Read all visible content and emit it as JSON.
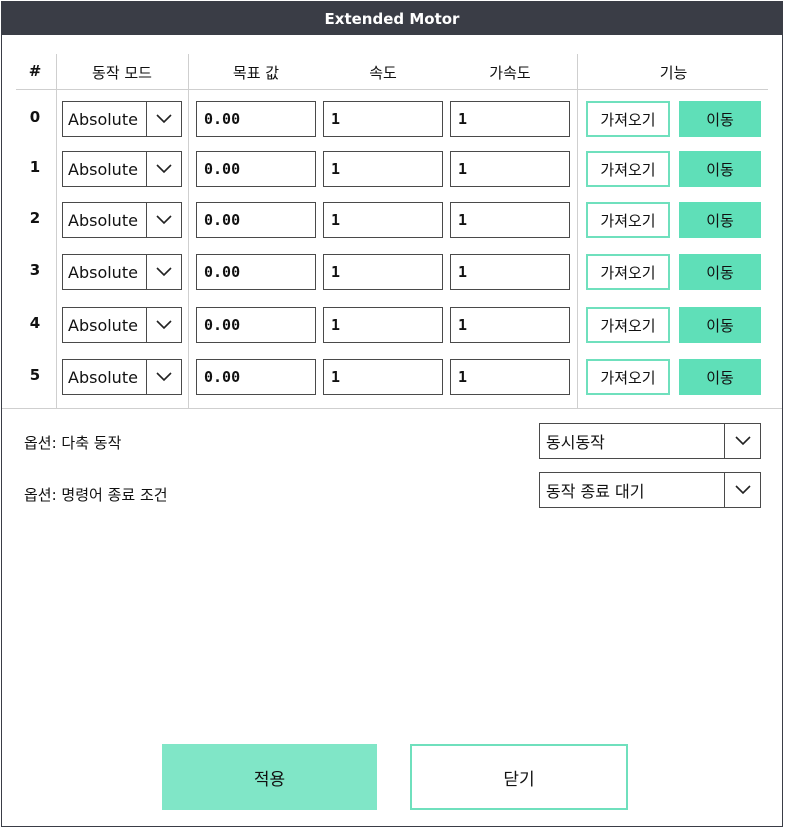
{
  "window": {
    "title": "Extended Motor"
  },
  "table": {
    "headers": {
      "index": "#",
      "mode": "동작 모드",
      "target": "목표 값",
      "speed": "속도",
      "accel": "가속도",
      "function": "기능"
    },
    "rows": [
      {
        "num": "0",
        "mode": "Absolute",
        "target": "0.00",
        "speed": "1",
        "accel": "1",
        "get_label": "가져오기",
        "move_label": "이동"
      },
      {
        "num": "1",
        "mode": "Absolute",
        "target": "0.00",
        "speed": "1",
        "accel": "1",
        "get_label": "가져오기",
        "move_label": "이동"
      },
      {
        "num": "2",
        "mode": "Absolute",
        "target": "0.00",
        "speed": "1",
        "accel": "1",
        "get_label": "가져오기",
        "move_label": "이동"
      },
      {
        "num": "3",
        "mode": "Absolute",
        "target": "0.00",
        "speed": "1",
        "accel": "1",
        "get_label": "가져오기",
        "move_label": "이동"
      },
      {
        "num": "4",
        "mode": "Absolute",
        "target": "0.00",
        "speed": "1",
        "accel": "1",
        "get_label": "가져오기",
        "move_label": "이동"
      },
      {
        "num": "5",
        "mode": "Absolute",
        "target": "0.00",
        "speed": "1",
        "accel": "1",
        "get_label": "가져오기",
        "move_label": "이동"
      }
    ]
  },
  "options": {
    "multi_axis": {
      "label": "옵션: 다축 동작",
      "value": "동시동작"
    },
    "end_condition": {
      "label": "옵션: 명령어 종료 조건",
      "value": "동작 종료 대기"
    }
  },
  "footer": {
    "apply_label": "적용",
    "close_label": "닫기"
  },
  "icons": {
    "dropdown": "chevron-down-icon"
  },
  "colors": {
    "accent": "#5fdfb8",
    "accent_light": "#80e6c7",
    "titlebar": "#3a3d46"
  }
}
